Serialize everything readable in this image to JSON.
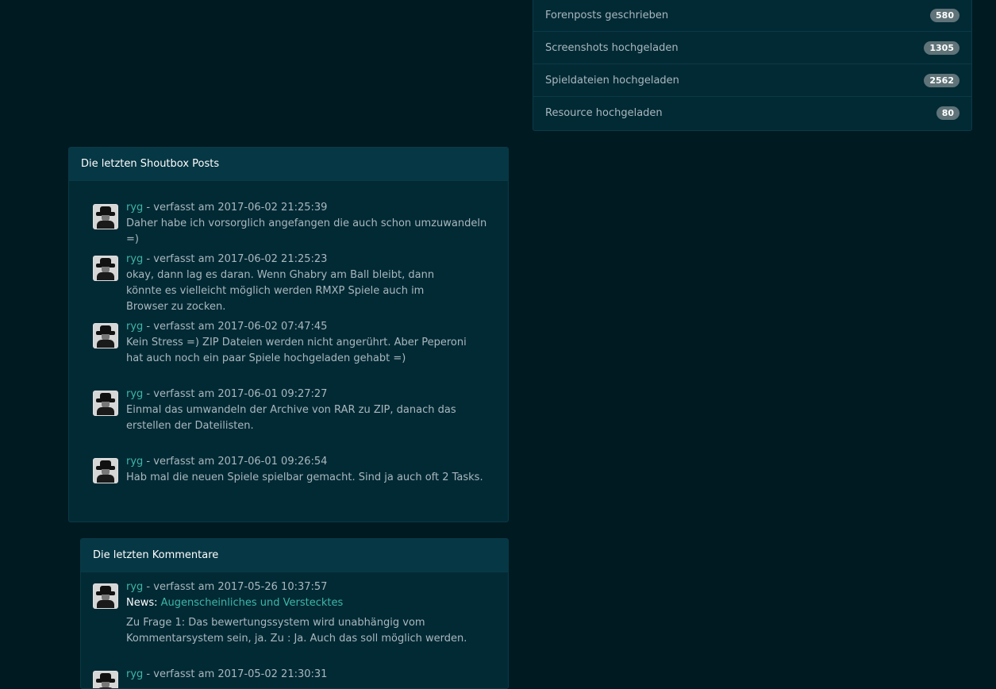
{
  "stats": [
    {
      "label": "Forenposts geschrieben",
      "count": "580"
    },
    {
      "label": "Screenshots hochgeladen",
      "count": "1305"
    },
    {
      "label": "Spieldateien hochgeladen",
      "count": "2562"
    },
    {
      "label": "Resource hochgeladen",
      "count": "80"
    }
  ],
  "shoutbox": {
    "title": "Die letzten Shoutbox Posts",
    "posts": [
      {
        "author": "ryg",
        "meta": " - verfasst am 2017-06-02 21:25:39",
        "text": "Daher habe ich vorsorglich angefangen die auch schon umzuwandeln =)"
      },
      {
        "author": "ryg",
        "meta": " - verfasst am 2017-06-02 21:25:23",
        "text": "okay, dann lag es daran. Wenn Ghabry am Ball bleibt, dann könnte es vielleicht möglich werden RMXP Spiele auch im Browser zu zocken."
      },
      {
        "author": "ryg",
        "meta": " - verfasst am 2017-06-02 07:47:45",
        "text": "Kein Stress =) ZIP Dateien werden nicht angerührt. Aber Peperoni hat auch noch ein paar Spiele hochgeladen gehabt =)"
      },
      {
        "author": "ryg",
        "meta": " - verfasst am 2017-06-01 09:27:27",
        "text": "Einmal das umwandeln der Archive von RAR zu ZIP, danach das erstellen der Dateilisten."
      },
      {
        "author": "ryg",
        "meta": " - verfasst am 2017-06-01 09:26:54",
        "text": "Hab mal die neuen Spiele spielbar gemacht. Sind ja auch oft 2 Tasks."
      }
    ]
  },
  "comments": {
    "title": "Die letzten Kommentare",
    "items": [
      {
        "author": "ryg",
        "meta": " - verfasst am 2017-05-26 10:37:57",
        "news_label": "News:",
        "news_link": "Augenscheinliches und Verstecktes",
        "text": "Zu Frage 1: Das bewertungssystem wird unabhängig vom Kommentarsystem sein, ja. Zu : Ja. Auch das soll möglich werden."
      },
      {
        "author": "ryg",
        "meta": " - verfasst am 2017-05-02 21:30:31"
      }
    ]
  }
}
